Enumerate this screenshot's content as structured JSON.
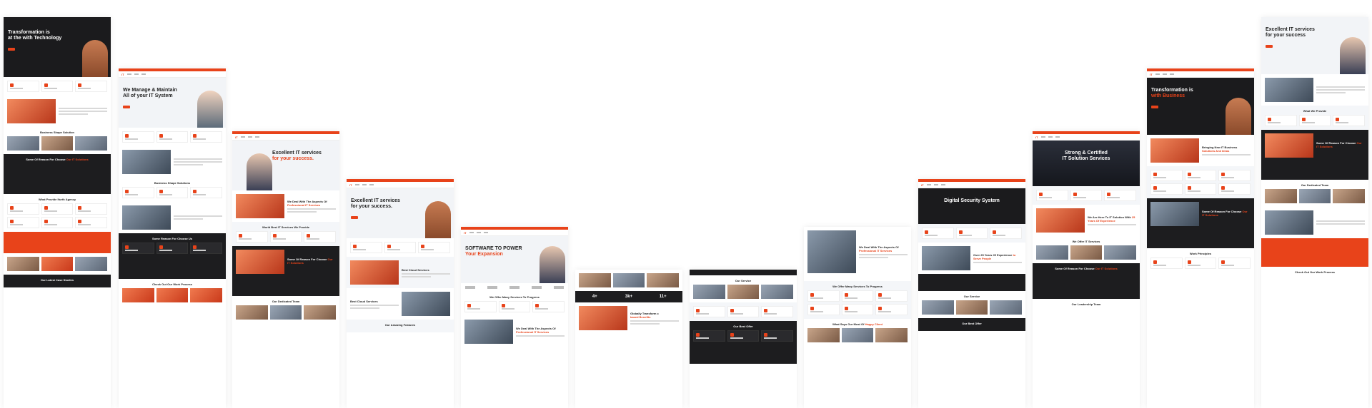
{
  "pages": [
    {
      "hero_title_a": "Transformation is",
      "hero_title_b": "at the with Technology",
      "sec1": "Business Shape Solution",
      "sec2a": "Some Of Reason For Choose",
      "sec2b": "Our IT Solutions",
      "sec3": "What Provide Ifurth Agency",
      "sec4": "Our Latest Case Studies"
    },
    {
      "hero_title_a": "We Manage & Maintain",
      "hero_title_b": "All of your IT System",
      "sec1": "Business Shape Solutions",
      "sec2": "Some Reason For Choose Us",
      "sec3": "Check Out Our Work Process"
    },
    {
      "hero_title_a": "Excellent IT services",
      "hero_title_b": "for your success.",
      "sec1a": "We Deal With The Aspects Of",
      "sec1b": "Professional IT Services",
      "sec2": "World Best IT Services We Provide",
      "sec3a": "Some Of Reason For Choose",
      "sec3b": "Our IT Solutions",
      "sec4": "Our Dedicated Team"
    },
    {
      "hero_title_a": "Excellent IT services",
      "hero_title_b": "for your success.",
      "sec1": "Best Cloud Services",
      "sec2": "Best Cloud Services",
      "sec3": "Our Amazing Features"
    },
    {
      "hero_title_a": "SOFTWARE TO POWER",
      "hero_title_b": "Your Expansion",
      "sec1": "We Offer Many Services To Progress",
      "sec2a": "We Deal With The Aspects Of",
      "sec2b": "Professional IT Services"
    },
    {
      "stats": [
        "4+",
        "3k+",
        "11+"
      ],
      "sec1a": "Globally Transform c",
      "sec1b": "based Benefits"
    },
    {
      "sec1": "Our Service",
      "sec2": "Our Best Offer"
    },
    {
      "hero_title_a": "We Deal With The Aspects Of",
      "hero_title_b": "Professional IT Services",
      "sec1": "We Offer Many Services To Progress",
      "sec2a": "What Says Our Most Of",
      "sec2b": "Happy Client"
    },
    {
      "hero_title_a": "Digital Security System",
      "sec1a": "Over 25 Years Of Experience",
      "sec1b": "to Serve People",
      "sec2": "Our Service",
      "sec3": "Our Best Offer"
    },
    {
      "hero_title_a": "Strong & Certified",
      "hero_title_b": "IT Solution Services",
      "sec1a": "We Are Here To IT Solution With",
      "sec1b": "25 Years Of Experience",
      "sec2": "We Offer IT Services",
      "sec3a": "Some Of Reason For Choose",
      "sec3b": "Our IT Solutions",
      "sec4": "Our Leadership Team"
    },
    {
      "hero_title_a": "Transformation is",
      "hero_title_b": "with Business",
      "sec1a": "Bringing New IT Business",
      "sec1b": "Solutions And Ideas",
      "sec2a": "Some Of Reason For Choose",
      "sec2b": "Our IT Solutions",
      "sec3": "Work Principles"
    },
    {
      "hero_title_a": "Excellent IT services",
      "hero_title_b": "for your success",
      "sec1": "What We Provide",
      "sec2a": "Some Of Reason For Choose",
      "sec2b": "Our IT Solutions",
      "sec3": "Our Dedicated Team",
      "sec4": "Check Out Our Work Process"
    }
  ]
}
